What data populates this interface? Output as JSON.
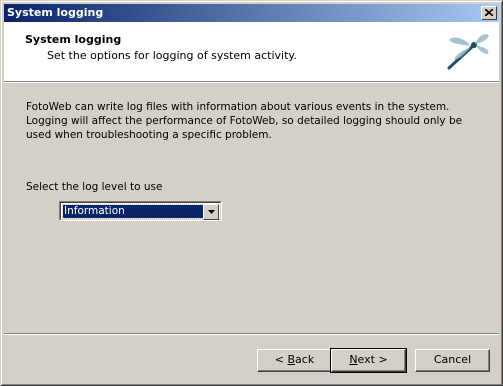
{
  "window": {
    "title": "System logging",
    "close_icon": "close-icon"
  },
  "header": {
    "title": "System logging",
    "subtitle": "Set the options for logging of system activity.",
    "logo_icon": "dragonfly-icon"
  },
  "main": {
    "description": "FotoWeb can write log files with information about various events in the system. Logging will affect the performance of FotoWeb, so detailed logging should only be used when troubleshooting a specific problem.",
    "log_level_label": "Select the log level to use",
    "log_level_value": "Information"
  },
  "buttons": {
    "back_prefix": "< ",
    "back_mnemonic": "B",
    "back_rest": "ack",
    "next_mnemonic": "N",
    "next_rest": "ext >",
    "cancel_label": "Cancel"
  },
  "colors": {
    "title_bar_start": "#0a246a",
    "title_bar_end": "#a6caf0",
    "dialog_bg": "#d4d0c8",
    "selection": "#0a246a"
  }
}
